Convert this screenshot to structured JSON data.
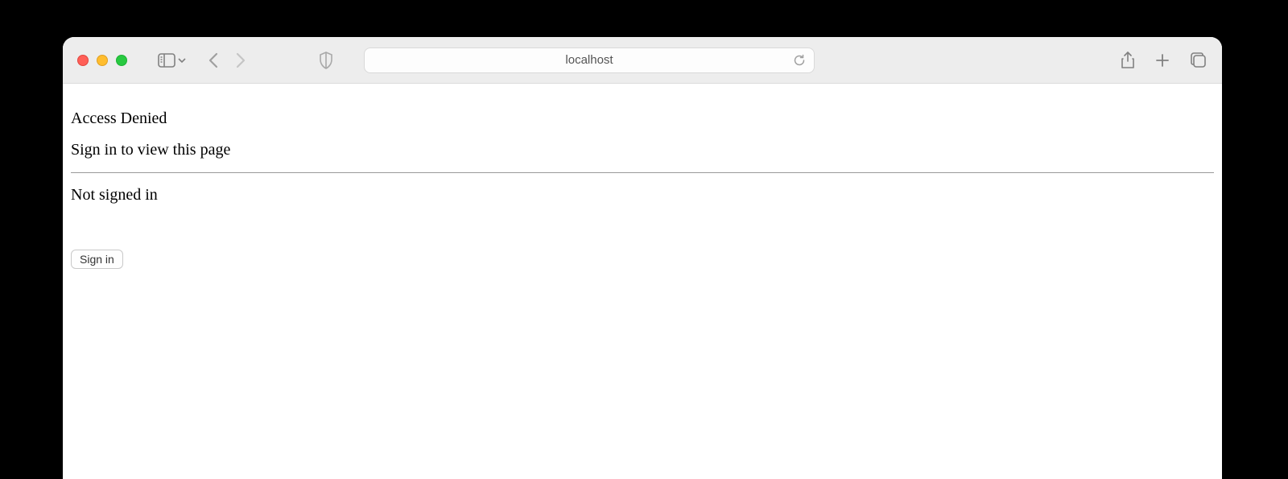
{
  "browser": {
    "address": "localhost"
  },
  "page": {
    "heading": "Access Denied",
    "subheading": "Sign in to view this page",
    "status": "Not signed in",
    "button_label": "Sign in"
  }
}
